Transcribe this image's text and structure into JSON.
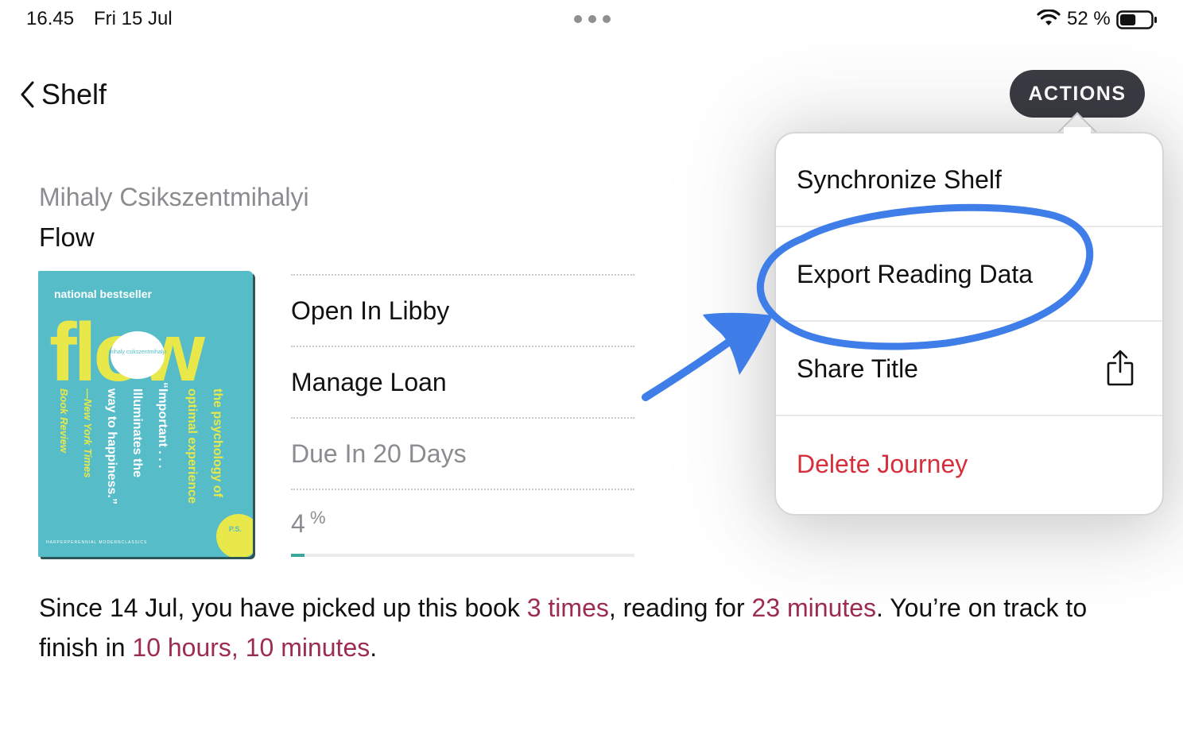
{
  "status_bar": {
    "time": "16.45",
    "date": "Fri 15 Jul",
    "battery_percent": "52 %",
    "battery_level": 0.52
  },
  "nav": {
    "back_label": "Shelf",
    "actions_label": "ACTIONS"
  },
  "book": {
    "author": "Mihaly Csikszentmihalyi",
    "title": "Flow",
    "cover": {
      "top_text": "national bestseller",
      "big_title": "flow",
      "badge_author": "mihaly csikszentmihalyi",
      "spine_lines": [
        "the psychology of",
        "optimal experience",
        "“Important . . .",
        "Illuminates the",
        "way to happiness.”",
        "—New York Times",
        "Book Review"
      ],
      "publisher": "HARPERPERENNIAL  MODERNCLASSICS",
      "ps_badge": "P.S.",
      "colors": {
        "background": "#56bcc8",
        "accent": "#e8e84a"
      }
    }
  },
  "options": {
    "open_in": "Open In Libby",
    "manage_loan": "Manage Loan",
    "due": "Due In 20 Days",
    "progress_value": "4",
    "progress_symbol": "%",
    "progress_fraction": 0.04
  },
  "summary": {
    "part1": "Since 14 Jul, you have picked up this book ",
    "times": "3 times",
    "part2": ", reading for ",
    "minutes": "23 minutes",
    "part3": ". You’re on track to finish in ",
    "finish": "10 hours, 10 minutes",
    "part4": "."
  },
  "menu": {
    "items": [
      "Synchronize Shelf",
      "Export Reading Data",
      "Share Title",
      "Delete Journey"
    ]
  },
  "colors": {
    "accent_dark": "#3b3c43",
    "highlight": "#9c2c52",
    "destructive": "#d62f3c",
    "progress": "#3aa79a",
    "annotation": "#3f7ee8"
  }
}
